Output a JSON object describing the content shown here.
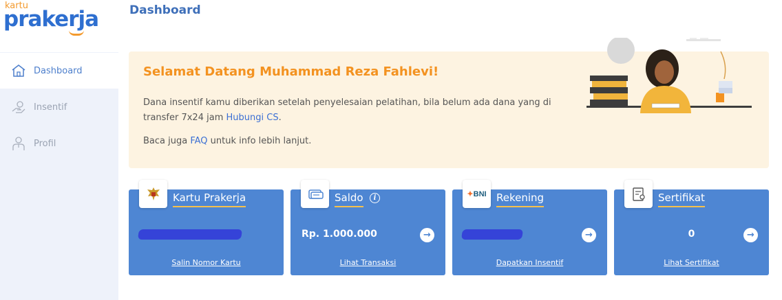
{
  "brand": {
    "logo_small": "kartu",
    "logo_big": "prakerja"
  },
  "sidebar": {
    "items": [
      {
        "label": "Dashboard",
        "icon": "home-icon",
        "active": true
      },
      {
        "label": "Insentif",
        "icon": "hand-money-icon",
        "active": false
      },
      {
        "label": "Profil",
        "icon": "user-icon",
        "active": false
      }
    ]
  },
  "header": {
    "title": "Dashboard"
  },
  "welcome": {
    "heading": "Selamat Datang Muhammad Reza Fahlevi!",
    "text_before_link": "Dana insentif kamu diberikan setelah penyelesaian pelatihan, bila belum ada dana yang di transfer 7x24 jam ",
    "cs_link": "Hubungi CS",
    "text_after_link": ".",
    "faq_before": "Baca juga ",
    "faq_link": "FAQ",
    "faq_after": " untuk info lebih lanjut."
  },
  "cards": [
    {
      "title": "Kartu Prakerja",
      "icon": "garuda-emblem-icon",
      "value": "",
      "link": "Salin Nomor Kartu"
    },
    {
      "title": "Saldo",
      "icon": "wallet-card-icon",
      "value": "Rp. 1.000.000",
      "link": "Lihat Transaksi"
    },
    {
      "title": "Rekening",
      "icon": "bni-logo-icon",
      "icon_text": "BNI",
      "value": "",
      "link": "Dapatkan Insentif"
    },
    {
      "title": "Sertifikat",
      "icon": "certificate-icon",
      "value": "0",
      "link": "Lihat Sertifikat"
    }
  ],
  "colors": {
    "primary": "#4e86d3",
    "accent": "#f39220",
    "welcome_bg": "#fdf3e1",
    "sidebar_bg": "#eef2fa",
    "redaction": "#3543d8"
  }
}
